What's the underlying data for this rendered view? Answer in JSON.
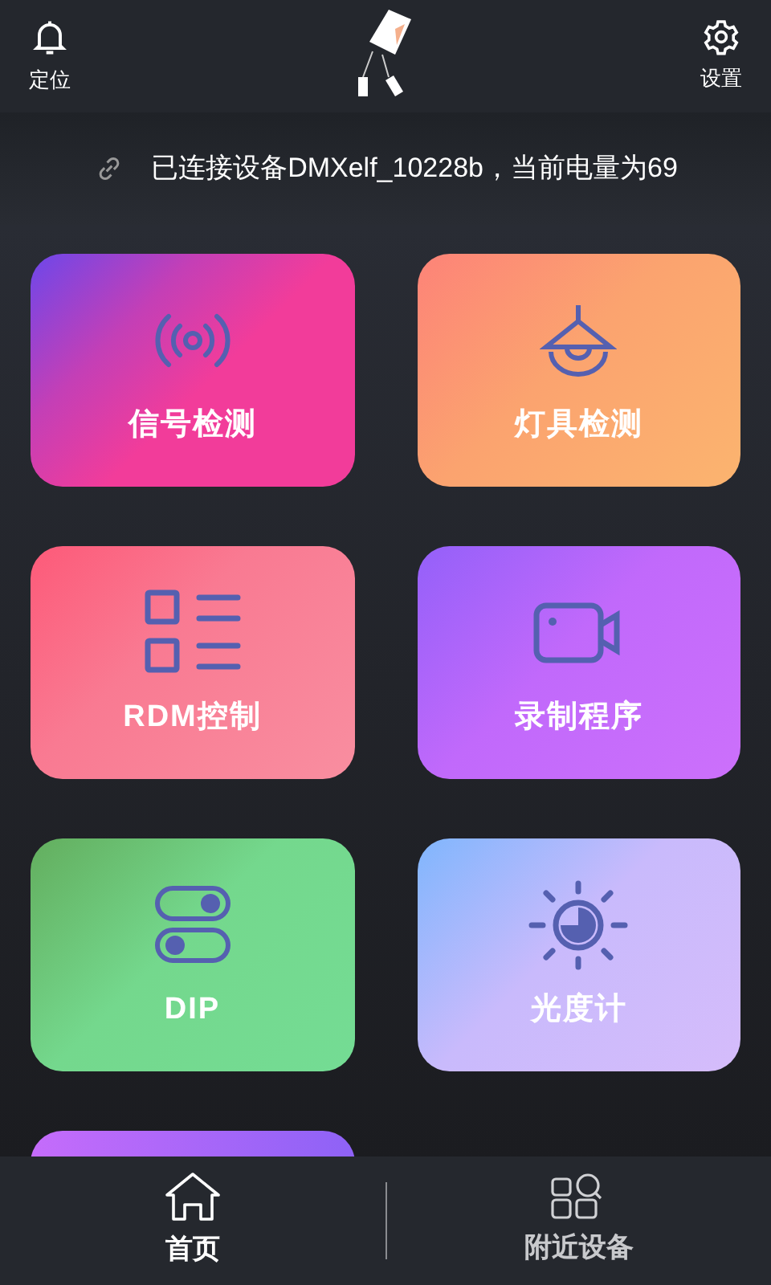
{
  "header": {
    "left": {
      "label": "定位"
    },
    "right": {
      "label": "设置"
    }
  },
  "status": {
    "text": "已连接设备DMXelf_10228b，当前电量为69"
  },
  "tiles": [
    {
      "kind": "signal",
      "label": "信号检测"
    },
    {
      "kind": "lamp",
      "label": "灯具检测"
    },
    {
      "kind": "list",
      "label": "RDM控制"
    },
    {
      "kind": "video",
      "label": "录制程序"
    },
    {
      "kind": "toggles",
      "label": "DIP"
    },
    {
      "kind": "sun",
      "label": "光度计"
    },
    {
      "kind": "partial"
    }
  ],
  "bottom_nav": [
    {
      "kind": "home",
      "label": "首页",
      "selected": true
    },
    {
      "kind": "nearby",
      "label": "附近设备",
      "selected": false
    }
  ]
}
